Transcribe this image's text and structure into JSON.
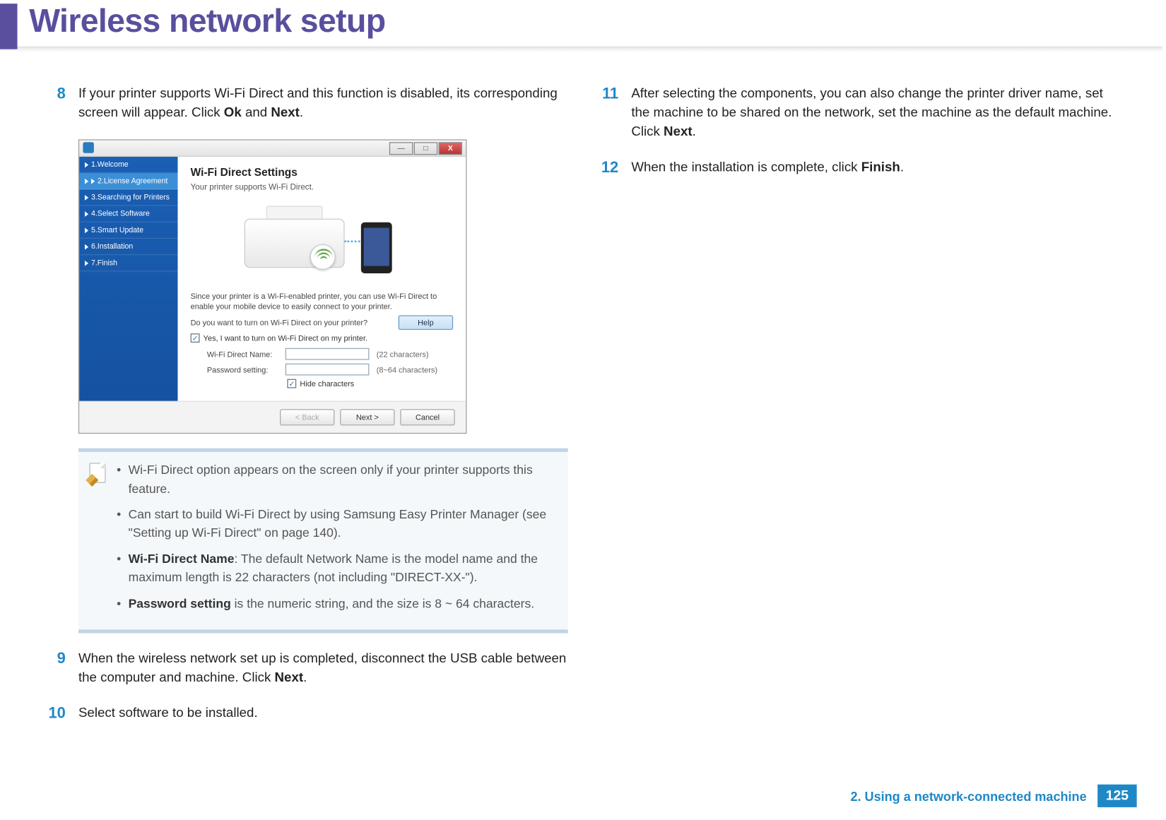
{
  "page_title": "Wireless network setup",
  "footer": {
    "chapter": "2.  Using a network-connected machine",
    "page": "125"
  },
  "steps": {
    "s8": {
      "num": "8",
      "text_before": "If your printer supports Wi-Fi Direct and this function is disabled, its corresponding screen will appear. Click ",
      "bold1": "Ok",
      "mid": " and ",
      "bold2": "Next",
      "after": "."
    },
    "s9": {
      "num": "9",
      "text_before": "When the wireless network set up is completed, disconnect the USB cable between the computer and machine. Click ",
      "bold1": "Next",
      "after": "."
    },
    "s10": {
      "num": "10",
      "text": "Select software to be installed."
    },
    "s11": {
      "num": "11",
      "text_before": "After selecting the components, you can also change the printer driver name, set the machine to be shared on the network, set the machine as the default machine. Click ",
      "bold1": "Next",
      "after": "."
    },
    "s12": {
      "num": "12",
      "text_before": "When the installation is complete, click ",
      "bold1": "Finish",
      "after": "."
    }
  },
  "dialog": {
    "title_heading": "Wi-Fi Direct Settings",
    "subtitle": "Your printer supports Wi-Fi Direct.",
    "sidebar": [
      "1.Welcome",
      "2.License Agreement",
      "3.Searching for Printers",
      "4.Select Software",
      "5.Smart Update",
      "6.Installation",
      "7.Finish"
    ],
    "desc1": "Since your printer is a Wi-Fi-enabled printer, you can use Wi-Fi Direct to enable your mobile device to easily connect to your printer.",
    "desc2": "Do you want to turn on Wi-Fi Direct on your printer?",
    "checkbox_label": "Yes, I want to turn on Wi-Fi Direct on my printer.",
    "help": "Help",
    "field1_label": "Wi-Fi Direct Name:",
    "field1_hint": "(22 characters)",
    "field2_label": "Password setting:",
    "field2_hint": "(8~64 characters)",
    "hide_chars": "Hide characters",
    "btn_back": "< Back",
    "btn_next": "Next >",
    "btn_cancel": "Cancel",
    "win_min": "—",
    "win_max": "□",
    "win_close": "X"
  },
  "notebox": {
    "bul1": "Wi-Fi Direct option appears on the screen only if your printer supports this feature.",
    "bul2": "Can start to build Wi-Fi Direct by using Samsung Easy Printer Manager (see \"Setting up Wi-Fi Direct\" on page 140).",
    "bul3_bold": "Wi-Fi Direct Name",
    "bul3_rest": ": The default Network Name is the model name and the maximum length is 22 characters (not including \"DIRECT-XX-\").",
    "bul4_bold": "Password setting",
    "bul4_rest": " is the numeric string, and the size is 8 ~ 64 characters."
  }
}
